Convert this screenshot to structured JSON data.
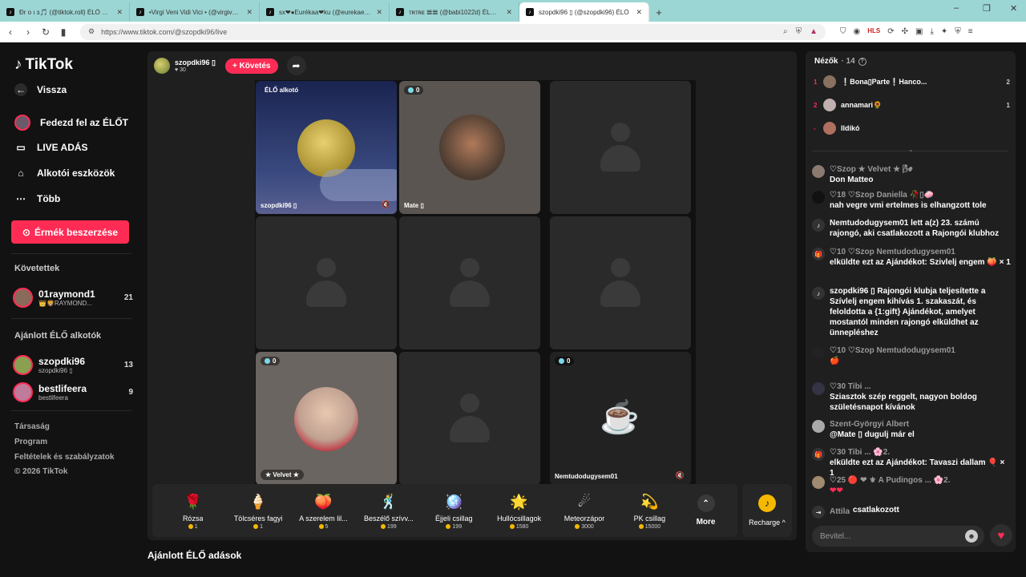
{
  "browser": {
    "tabs": [
      {
        "title": "Đr o ı ɜ🎵 (@tiktok.roll) ÉLŐ adá",
        "active": false
      },
      {
        "title": "•Virgi Veni Vidi Vici • (@virgivenivid",
        "active": false
      },
      {
        "title": "sx❤●Eurékaa❤ku (@eurekaeurek",
        "active": false
      },
      {
        "title": "ᴛʀᴛʀᴇ 𝌆𝌆 (@babi1022d) ÉLŐ adásba",
        "active": false
      },
      {
        "title": "szopdki96 ▯ (@szopdki96) ÉLŐ",
        "active": true
      }
    ],
    "new_tab": "+",
    "url": "https://www.tiktok.com/@szopdki96/live",
    "window_controls": [
      "–",
      "❐",
      "✕"
    ]
  },
  "sidebar": {
    "logo": "TikTok",
    "back": "Vissza",
    "items": [
      {
        "label": "Fedezd fel az ÉLŐT",
        "icon": "live-avatar-icon"
      },
      {
        "label": "LIVE ADÁS",
        "icon": "camera-icon"
      },
      {
        "label": "Alkotói eszközök",
        "icon": "house-icon"
      },
      {
        "label": "Több",
        "icon": "more-dots-icon"
      }
    ],
    "coins_button": "Érmék beszerzése",
    "following_heading": "Követettek",
    "following": [
      {
        "name": "01raymond1",
        "sub": "👑🦁RAYMOND...",
        "count": "21"
      }
    ],
    "recommended_heading": "Ajánlott ÉLŐ alkotók",
    "recommended": [
      {
        "name": "szopdki96",
        "sub": "szopdki96 ▯",
        "count": "13"
      },
      {
        "name": "bestlifeera",
        "sub": "bestlifeera",
        "count": "9"
      }
    ],
    "footer": [
      "Társaság",
      "Program",
      "Feltételek és szabályzatok",
      "© 2026 TikTok"
    ]
  },
  "stage": {
    "host_name": "szopdki96 ▯",
    "host_likes": "♥ 30",
    "follow": "+ Követés",
    "creator_label": "ÉLŐ alkotó",
    "cells": [
      {
        "name": "szopdki96 ▯",
        "badge": ""
      },
      {
        "name": "Mate ▯",
        "badge": "0"
      },
      {
        "name": "",
        "badge": ""
      },
      {
        "name": "",
        "badge": ""
      },
      {
        "name": "",
        "badge": ""
      },
      {
        "name": "",
        "badge": ""
      },
      {
        "name": "★ Velvet ★",
        "badge": "0"
      },
      {
        "name": "",
        "badge": ""
      },
      {
        "name": "Nemtudodugysem01",
        "badge": "0"
      }
    ]
  },
  "gifts": [
    {
      "name": "Rózsa",
      "price": "1",
      "icon": "🌹"
    },
    {
      "name": "Tölcséres fagyi",
      "price": "1",
      "icon": "🍦"
    },
    {
      "name": "A szerelem lil...",
      "price": "5",
      "icon": "🍑"
    },
    {
      "name": "Beszélő szívv...",
      "price": "199",
      "icon": "🕺"
    },
    {
      "name": "Éjjeli csillag",
      "price": "199",
      "icon": "🪩"
    },
    {
      "name": "Hullócsillagok",
      "price": "1580",
      "icon": "🌟"
    },
    {
      "name": "Meteorzápor",
      "price": "3000",
      "icon": "☄"
    },
    {
      "name": "PK csillag",
      "price": "15000",
      "icon": "💫"
    }
  ],
  "more_label": "More",
  "recharge_label": "Recharge ^",
  "recommend_title": "Ajánlott ÉLŐ adások",
  "chat": {
    "viewers_label": "Nézők",
    "viewers_count": "· 14",
    "viewers": [
      {
        "rank": "1",
        "name": "❕Bona▯Parte❕Hanco...",
        "count": "2"
      },
      {
        "rank": "2",
        "name": "annamari🌻",
        "count": "1"
      },
      {
        "rank": "-",
        "name": "Ildikó",
        "count": ""
      }
    ],
    "messages": [
      {
        "head": "♡Szop ★ Velvet ★ 🌬",
        "text": "Don Matteo"
      },
      {
        "head": "♡18 ♡Szop Daniella 🥀▯🧼",
        "text": "nah vegre vmi ertelmes is elhangzott tole"
      },
      {
        "head": "",
        "text": "Nemtudodugysem01 lett a(z) 23. számú rajongó, aki csatlakozott a Rajongói klubhoz"
      },
      {
        "head": "♡10 ♡Szop Nemtudodugysem01",
        "text": "elküldte ezt az Ajándékot: Szivlelj engem 🍑 × 1"
      },
      {
        "head": "",
        "text": "szopdki96 ▯ Rajongói klubja teljesítette a Szívlelj engem kihívás 1. szakaszát, és feloldotta a {1:gift} Ajándékot, amelyet mostantól minden rajongó elküldhet az ünnepléshez"
      },
      {
        "head": "♡10 ♡Szop Nemtudodugysem01",
        "text": "🍎"
      },
      {
        "head": "♡30 Tibi ...",
        "text": "Sziasztok szép reggelt, nagyon boldog születésnapot kívánok"
      },
      {
        "head": "Szent-Györgyi Albert",
        "text": "@Mate ▯ dugulj már el"
      },
      {
        "head": "♡30 Tibi ... 🌸2.",
        "text": "elküldte ezt az Ajándékot: Tavaszi dallam 🎈 × 1"
      },
      {
        "head": "♡25 🔴 ❤ ⚜ A Pudingos ... 🌸2.",
        "text": "❤❤"
      },
      {
        "head": "Attila",
        "text": "csatlakozott"
      }
    ],
    "input_placeholder": "Bevitel..."
  }
}
